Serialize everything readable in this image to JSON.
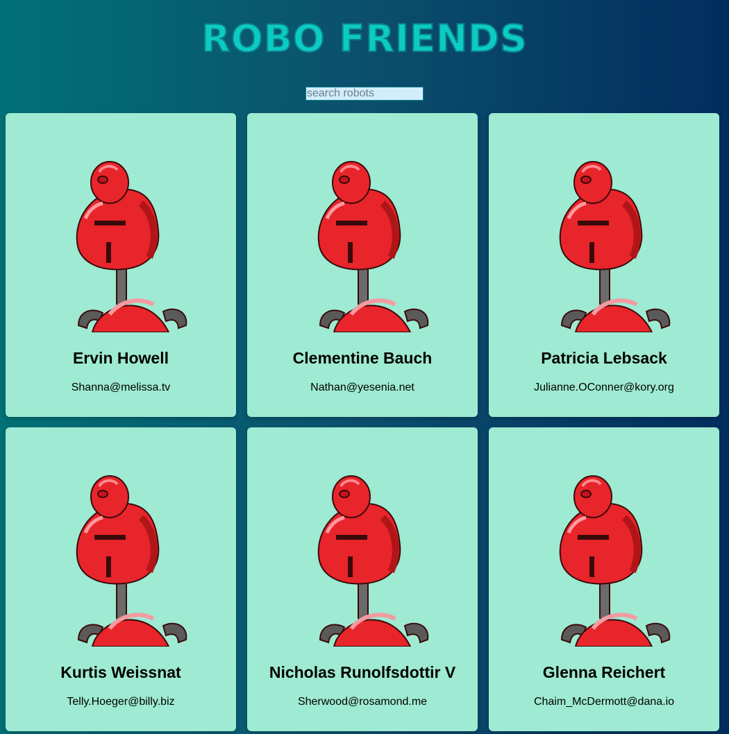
{
  "app": {
    "title": "ROBO FRIENDS"
  },
  "search": {
    "placeholder": "search robots",
    "value": ""
  },
  "colors": {
    "background_left": "#017176",
    "background_right": "#022d5e",
    "title": "#0ccac4",
    "card": "#9eead2",
    "robot_red": "#e8252b"
  },
  "robots": [
    {
      "name": "Ervin Howell",
      "email": "Shanna@melissa.tv",
      "icon": "robot-icon"
    },
    {
      "name": "Clementine Bauch",
      "email": "Nathan@yesenia.net",
      "icon": "robot-icon"
    },
    {
      "name": "Patricia Lebsack",
      "email": "Julianne.OConner@kory.org",
      "icon": "robot-icon"
    },
    {
      "name": "Kurtis Weissnat",
      "email": "Telly.Hoeger@billy.biz",
      "icon": "robot-icon"
    },
    {
      "name": "Nicholas Runolfsdottir V",
      "email": "Sherwood@rosamond.me",
      "icon": "robot-icon"
    },
    {
      "name": "Glenna Reichert",
      "email": "Chaim_McDermott@dana.io",
      "icon": "robot-icon"
    }
  ]
}
